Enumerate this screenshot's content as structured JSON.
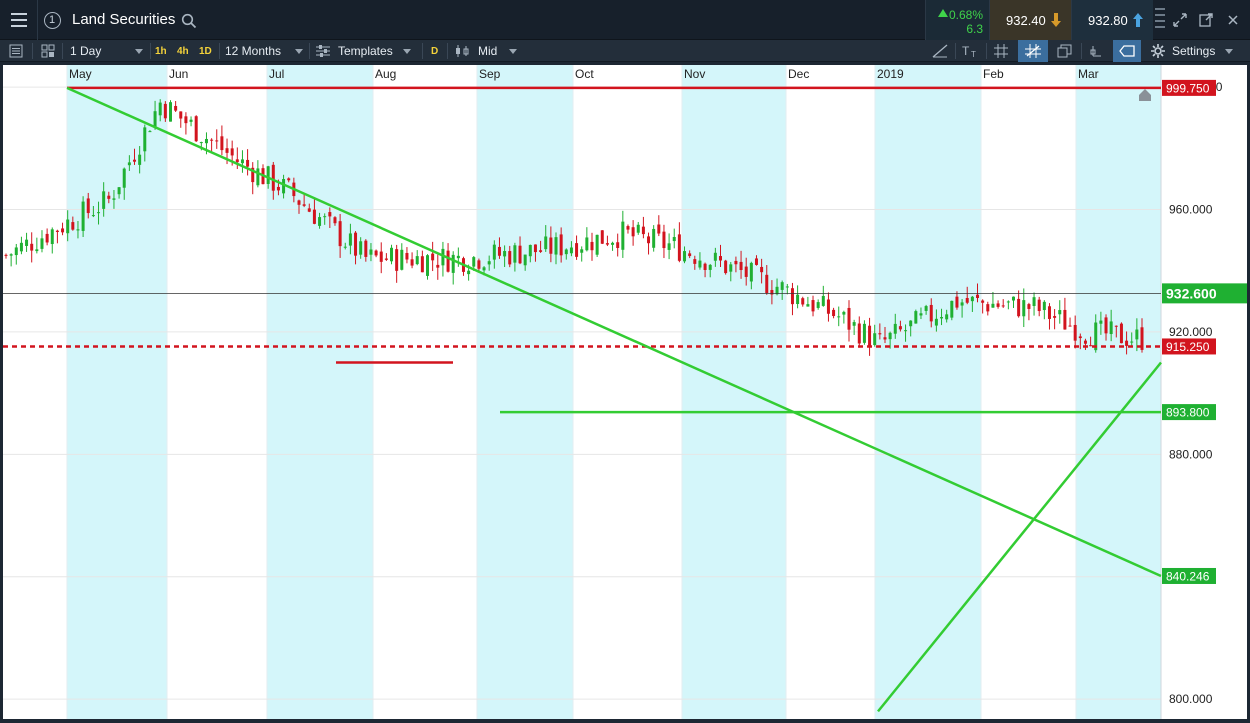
{
  "header": {
    "title": "Land Securities",
    "change_pct": "0.68%",
    "change_abs": "6.3",
    "sell_price": "932.40",
    "buy_price": "932.80",
    "order_btn": "1"
  },
  "toolbar": {
    "interval": "1 Day",
    "quick_intervals": [
      "1h",
      "4h",
      "1D"
    ],
    "range": "12 Months",
    "templates": "Templates",
    "d_badge": "D",
    "price_type": "Mid",
    "settings": "Settings"
  },
  "colors": {
    "bull": "#1fb032",
    "bear": "#d2141e",
    "trendline": "#33cc33",
    "band": "#d4f6fa",
    "resistance": "#d2141e"
  },
  "chart_data": {
    "type": "candlestick",
    "x_labels": [
      "May",
      "Jun",
      "Jul",
      "Aug",
      "Sep",
      "Oct",
      "Nov",
      "Dec",
      "2019",
      "Feb",
      "Mar"
    ],
    "y_ticks": [
      "1,000.000",
      "960.000",
      "920.000",
      "880.000",
      "840.000",
      "800.000"
    ],
    "y_tick_values": [
      1000,
      960,
      920,
      880,
      840,
      800
    ],
    "ylim": [
      792,
      1002
    ],
    "price_labels": [
      {
        "text": "999.750",
        "value": 999.75,
        "color": "#d2141e"
      },
      {
        "text": "932.600",
        "value": 932.6,
        "color": "#1fb032"
      },
      {
        "text": "915.250",
        "value": 915.25,
        "color": "#d2141e"
      },
      {
        "text": "893.800",
        "value": 893.8,
        "color": "#1fb032"
      },
      {
        "text": "840.246",
        "value": 840.246,
        "color": "#1fb032"
      }
    ],
    "current_price": 932.6,
    "horizontal_lines": [
      {
        "value": 999.75,
        "style": "solid",
        "color": "#d2141e"
      },
      {
        "value": 915.25,
        "style": "dashed",
        "color": "#d2141e"
      },
      {
        "value": 893.8,
        "style": "solid",
        "color": "#33cc33"
      },
      {
        "value": 910.0,
        "style": "solid",
        "color": "#d2141e",
        "from": "Jul",
        "to": "Aug"
      }
    ],
    "trendlines": [
      {
        "from": {
          "date": "2018-04-30",
          "value": 999.75
        },
        "to": {
          "date": "2019-03-15",
          "value": 840.246
        }
      },
      {
        "from": {
          "date": "2019-01-02",
          "value": 796
        },
        "to": {
          "date": "2019-03-15",
          "value": 910
        }
      }
    ],
    "waypoints": [
      [
        0,
        945
      ],
      [
        20,
        963
      ],
      [
        30,
        995
      ],
      [
        45,
        976
      ],
      [
        55,
        966
      ],
      [
        70,
        944
      ],
      [
        90,
        944
      ],
      [
        105,
        947
      ],
      [
        120,
        952
      ],
      [
        130,
        948
      ],
      [
        150,
        935
      ],
      [
        162,
        925
      ],
      [
        170,
        916
      ],
      [
        185,
        930
      ],
      [
        200,
        928
      ],
      [
        210,
        920
      ],
      [
        225,
        917
      ],
      [
        235,
        928
      ],
      [
        245,
        900
      ],
      [
        260,
        887
      ],
      [
        275,
        887
      ],
      [
        290,
        886
      ],
      [
        300,
        876
      ],
      [
        320,
        860
      ],
      [
        330,
        820
      ],
      [
        345,
        832
      ],
      [
        360,
        864
      ],
      [
        375,
        866
      ],
      [
        385,
        874
      ],
      [
        395,
        856
      ],
      [
        410,
        844
      ],
      [
        425,
        854
      ],
      [
        435,
        834
      ],
      [
        445,
        838
      ],
      [
        460,
        836
      ],
      [
        480,
        812
      ],
      [
        500,
        834
      ],
      [
        520,
        846
      ],
      [
        535,
        868
      ],
      [
        545,
        858
      ],
      [
        555,
        848
      ],
      [
        570,
        858
      ],
      [
        580,
        873
      ],
      [
        600,
        872
      ],
      [
        610,
        888
      ],
      [
        630,
        884
      ],
      [
        650,
        904
      ],
      [
        670,
        900
      ],
      [
        690,
        907
      ],
      [
        705,
        897
      ],
      [
        720,
        899
      ],
      [
        735,
        930
      ]
    ],
    "candle_count": 222
  }
}
